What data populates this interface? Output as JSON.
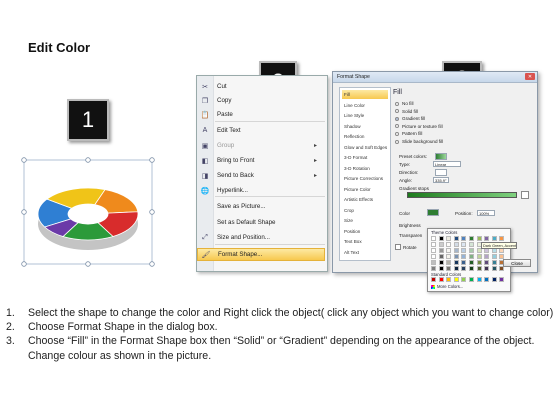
{
  "title": "Edit Color",
  "badges": [
    "1",
    "2",
    "3"
  ],
  "ring_colors": {
    "blue": "#2f7fd3",
    "yellow": "#f0c418",
    "orange": "#ef8a1c",
    "red": "#d82c2c",
    "green": "#2c9a3a",
    "purple": "#6b3aa8"
  },
  "context_menu": {
    "items": [
      {
        "label": "Cut",
        "icon": "scissors-icon",
        "glyph": "✂"
      },
      {
        "label": "Copy",
        "icon": "copy-icon",
        "glyph": "❐"
      },
      {
        "label": "Paste",
        "icon": "paste-icon",
        "glyph": "📋"
      },
      {
        "label": "Edit Text",
        "icon": "edit-text-icon",
        "glyph": "A"
      },
      {
        "label": "Group",
        "icon": "group-icon",
        "glyph": "▣",
        "disabled": true,
        "submenu": true
      },
      {
        "label": "Bring to Front",
        "icon": "bring-front-icon",
        "glyph": "◧",
        "submenu": true
      },
      {
        "label": "Send to Back",
        "icon": "send-back-icon",
        "glyph": "◨",
        "submenu": true
      },
      {
        "label": "Hyperlink...",
        "icon": "hyperlink-icon",
        "glyph": "🌐"
      },
      {
        "label": "Save as Picture...",
        "icon": "",
        "glyph": ""
      },
      {
        "label": "Set as Default Shape",
        "icon": "",
        "glyph": ""
      },
      {
        "label": "Size and Position...",
        "icon": "size-position-icon",
        "glyph": "⤢"
      },
      {
        "label": "Format Shape...",
        "icon": "format-shape-icon",
        "glyph": "🖌",
        "highlight": true
      }
    ]
  },
  "dialog": {
    "title": "Format Shape",
    "close_glyph": "✕",
    "sidebar": [
      "Fill",
      "Line Color",
      "Line Style",
      "Shadow",
      "Reflection",
      "Glow and Soft Edges",
      "3-D Format",
      "3-D Rotation",
      "Picture Corrections",
      "Picture Color",
      "Artistic Effects",
      "Crop",
      "Size",
      "Position",
      "Text Box",
      "Alt Text"
    ],
    "fill_heading": "Fill",
    "fill_options": [
      {
        "label": "No fill",
        "selected": false
      },
      {
        "label": "Solid fill",
        "selected": false
      },
      {
        "label": "Gradient fill",
        "selected": true
      },
      {
        "label": "Picture or texture fill",
        "selected": false
      },
      {
        "label": "Pattern fill",
        "selected": false
      },
      {
        "label": "Slide background fill",
        "selected": false
      }
    ],
    "preset_colors_label": "Preset colors:",
    "type_label": "Type:",
    "type_value": "Linear",
    "direction_label": "Direction:",
    "angle_label": "Angle:",
    "angle_value": "335.9°",
    "gradient_stops_label": "Gradient stops",
    "color_label": "Color",
    "position_label": "Position:",
    "position_value": "100%",
    "brightness_label": "Brightness",
    "transparency_label": "Transparen",
    "rotate_label": "Rotate",
    "close_button": "Close"
  },
  "palette": {
    "theme_label": "Theme Colors",
    "standard_label": "Standard Colors",
    "more_label": "More Colors...",
    "tooltip": "Dark Green, Accent 2",
    "theme_top": [
      "#ffffff",
      "#000000",
      "#eeece1",
      "#1f497d",
      "#4f81bd",
      "#2e7d32",
      "#9bbb59",
      "#8064a2",
      "#4bacc6",
      "#f79646"
    ],
    "standard": [
      "#c00000",
      "#ff0000",
      "#ffc000",
      "#ffff00",
      "#92d050",
      "#00b050",
      "#00b0f0",
      "#0070c0",
      "#002060",
      "#7030a0"
    ]
  },
  "steps": [
    {
      "num": "1.",
      "text": "Select the shape to change the color and Right click the object( click any object which you want to change color)"
    },
    {
      "num": "2.",
      "text": "Choose Format Shape in the dialog box."
    },
    {
      "num": "3.",
      "text": "Choose “Fill” in the Format Shape box then “Solid” or “Gradient” depending on the appearance of the object. Change colour as shown in the picture."
    }
  ]
}
